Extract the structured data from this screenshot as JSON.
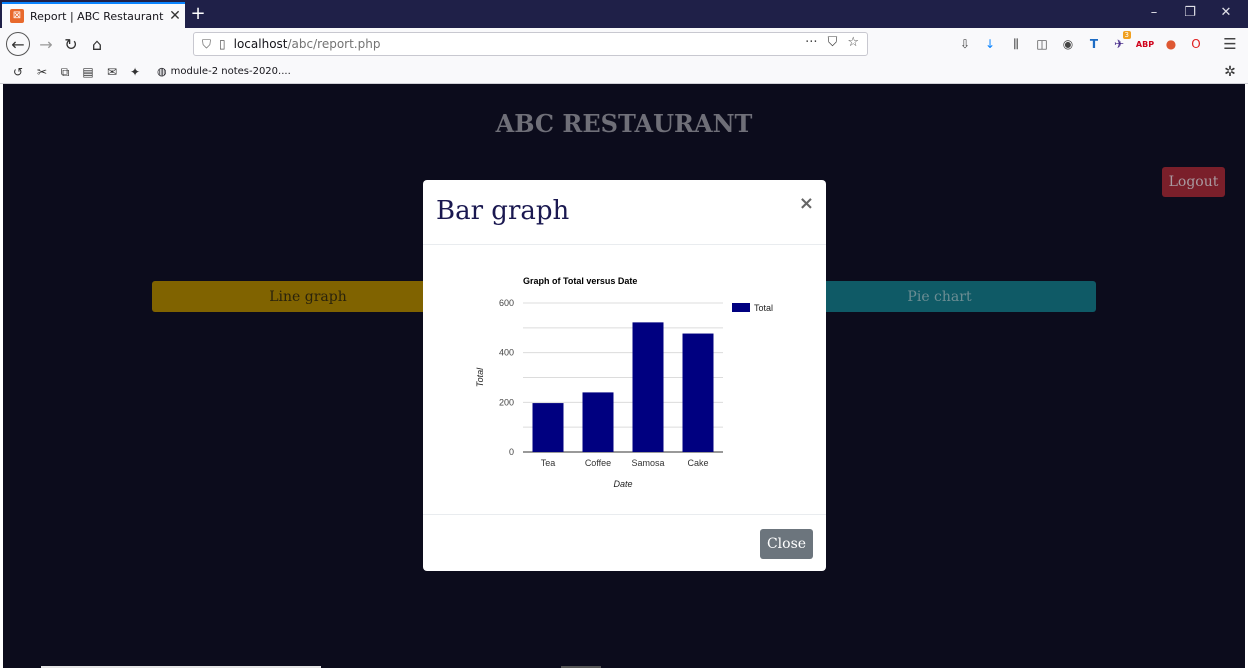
{
  "browser": {
    "tab_title": "Report | ABC Restaurant",
    "url_host": "localhost",
    "url_path": "/abc/report.php",
    "bookmark_label": "module-2 notes-2020....",
    "extension_badge": "3"
  },
  "page": {
    "site_title": "ABC RESTAURANT",
    "logout_label": "Logout",
    "line_graph_label": "Line graph",
    "pie_chart_label": "Pie chart"
  },
  "modal": {
    "title": "Bar graph",
    "close_x": "×",
    "close_button_label": "Close"
  },
  "chart_data": {
    "type": "bar",
    "title": "Graph of Total versus Date",
    "xlabel": "Date",
    "ylabel": "Total",
    "categories": [
      "Tea",
      "Coffee",
      "Samosa",
      "Cake"
    ],
    "series": [
      {
        "name": "Total",
        "values": [
          197,
          240,
          522,
          477
        ],
        "color": "#000080"
      }
    ],
    "ylim": [
      0,
      600
    ],
    "yticks": [
      0,
      200,
      400,
      600
    ],
    "grid": true,
    "legend_position": "right"
  }
}
